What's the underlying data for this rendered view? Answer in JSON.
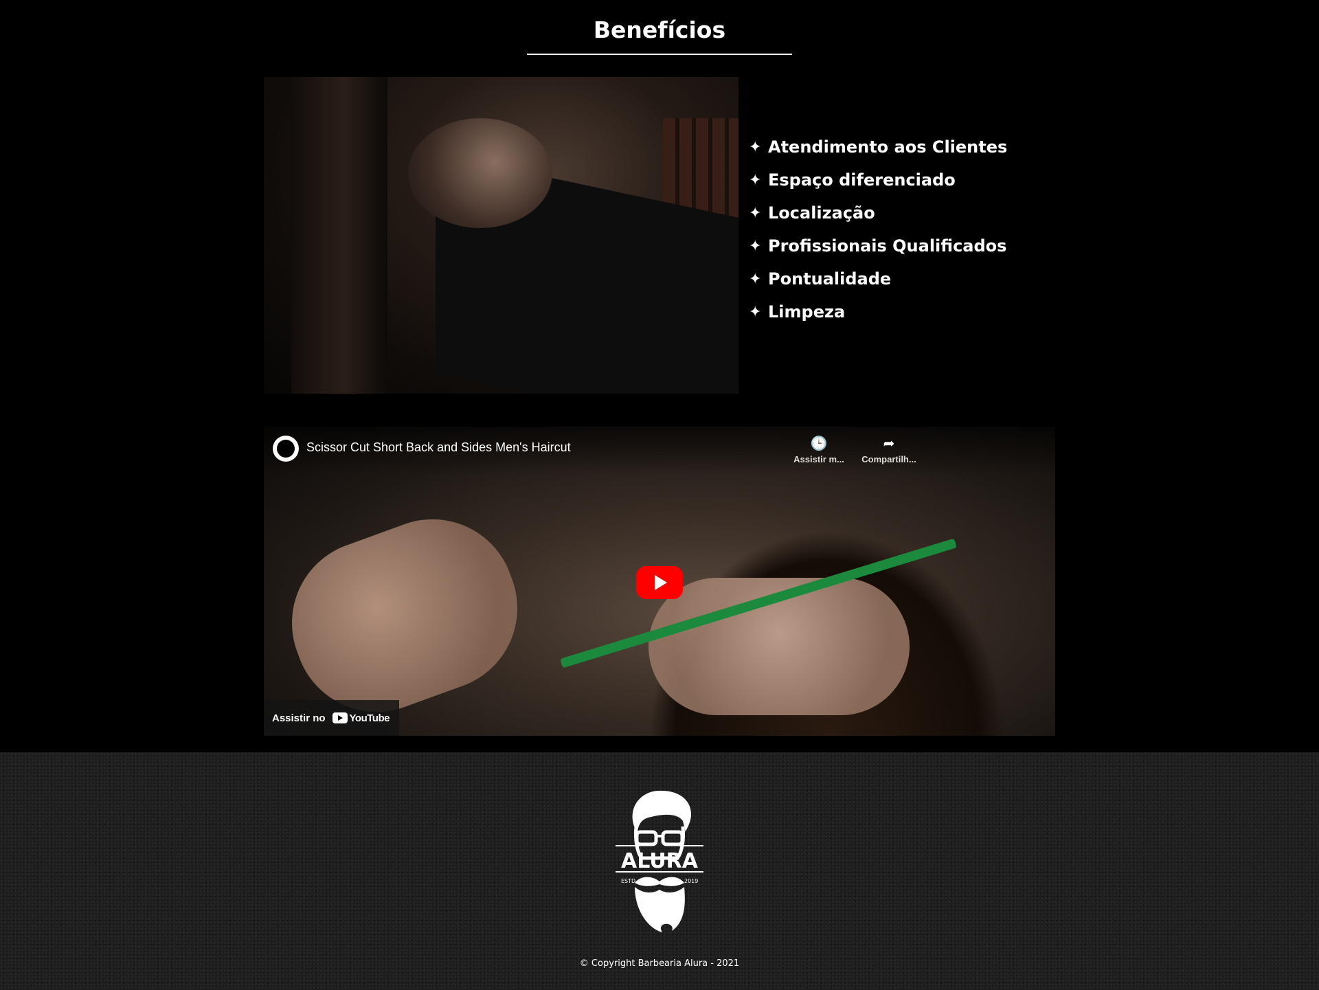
{
  "section": {
    "title": "Benefícios"
  },
  "benefits": {
    "items": [
      "Atendimento aos Clientes",
      "Espaço diferenciado",
      "Localização",
      "Profissionais Qualificados",
      "Pontualidade",
      "Limpeza"
    ],
    "bullet_icon": "sparkle-star"
  },
  "video": {
    "title": "Scissor Cut Short Back and Sides Men's Haircut",
    "watch_later_label": "Assistir m...",
    "share_label": "Compartilh...",
    "watch_on_label": "Assistir no",
    "youtube_label": "YouTube",
    "play_color": "#ff0000"
  },
  "footer": {
    "logo": {
      "name": "ALURA",
      "estd": "ESTD",
      "year": "2019"
    },
    "copyright": "© Copyright Barbearia Alura - 2021"
  }
}
